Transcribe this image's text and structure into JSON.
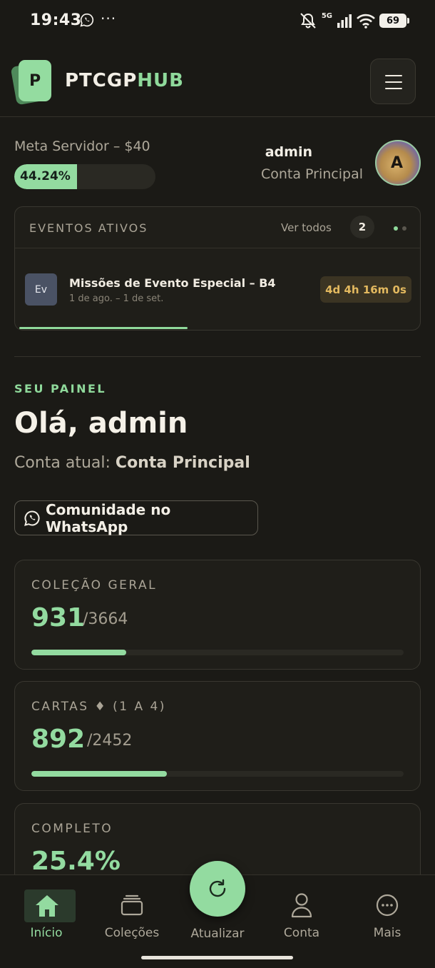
{
  "status_bar": {
    "time": "19:43",
    "network": "5G",
    "battery": "69",
    "more": "···"
  },
  "header": {
    "logo_letter": "P",
    "brand_part1": "PTCGP",
    "brand_part2": "HUB"
  },
  "meta": {
    "label": "Meta Servidor – $40",
    "progress_text": "44.24%",
    "progress": 0.4424
  },
  "user": {
    "name": "admin",
    "account": "Conta Principal",
    "avatar_letter": "A"
  },
  "events": {
    "title": "EVENTOS ATIVOS",
    "see_all": "Ver todos",
    "count": "2",
    "items": [
      {
        "icon": "Ev",
        "name": "Missões de Evento Especial – B4",
        "dates": "1 de ago. – 1 de set.",
        "countdown": "4d 4h 16m 0s",
        "progress": 0.42
      }
    ]
  },
  "panel": {
    "eyebrow": "SEU PAINEL",
    "greeting": "Olá, admin",
    "account_prefix": "Conta atual:",
    "account_name": "Conta Principal",
    "whatsapp_label": "Comunidade no WhatsApp"
  },
  "stats": [
    {
      "title": "COLEÇÃO GERAL",
      "value": "931",
      "total": "/3664",
      "progress": 0.254
    },
    {
      "title": "CARTAS ♦ (1 A 4)",
      "value": "892",
      "total": "/2452",
      "progress": 0.364
    },
    {
      "title": "COMPLETO",
      "value": "25.4%"
    }
  ],
  "nav": {
    "items": [
      {
        "label": "Início",
        "icon": "home-icon",
        "active": true
      },
      {
        "label": "Coleções",
        "icon": "collections-icon"
      },
      {
        "label": "Atualizar",
        "icon": "refresh-icon"
      },
      {
        "label": "Conta",
        "icon": "user-icon"
      },
      {
        "label": "Mais",
        "icon": "more-icon"
      }
    ]
  },
  "colors": {
    "accent": "#93dba0",
    "background": "#1b1a16",
    "card": "#1f1e19",
    "timer": "#e3b95f"
  }
}
